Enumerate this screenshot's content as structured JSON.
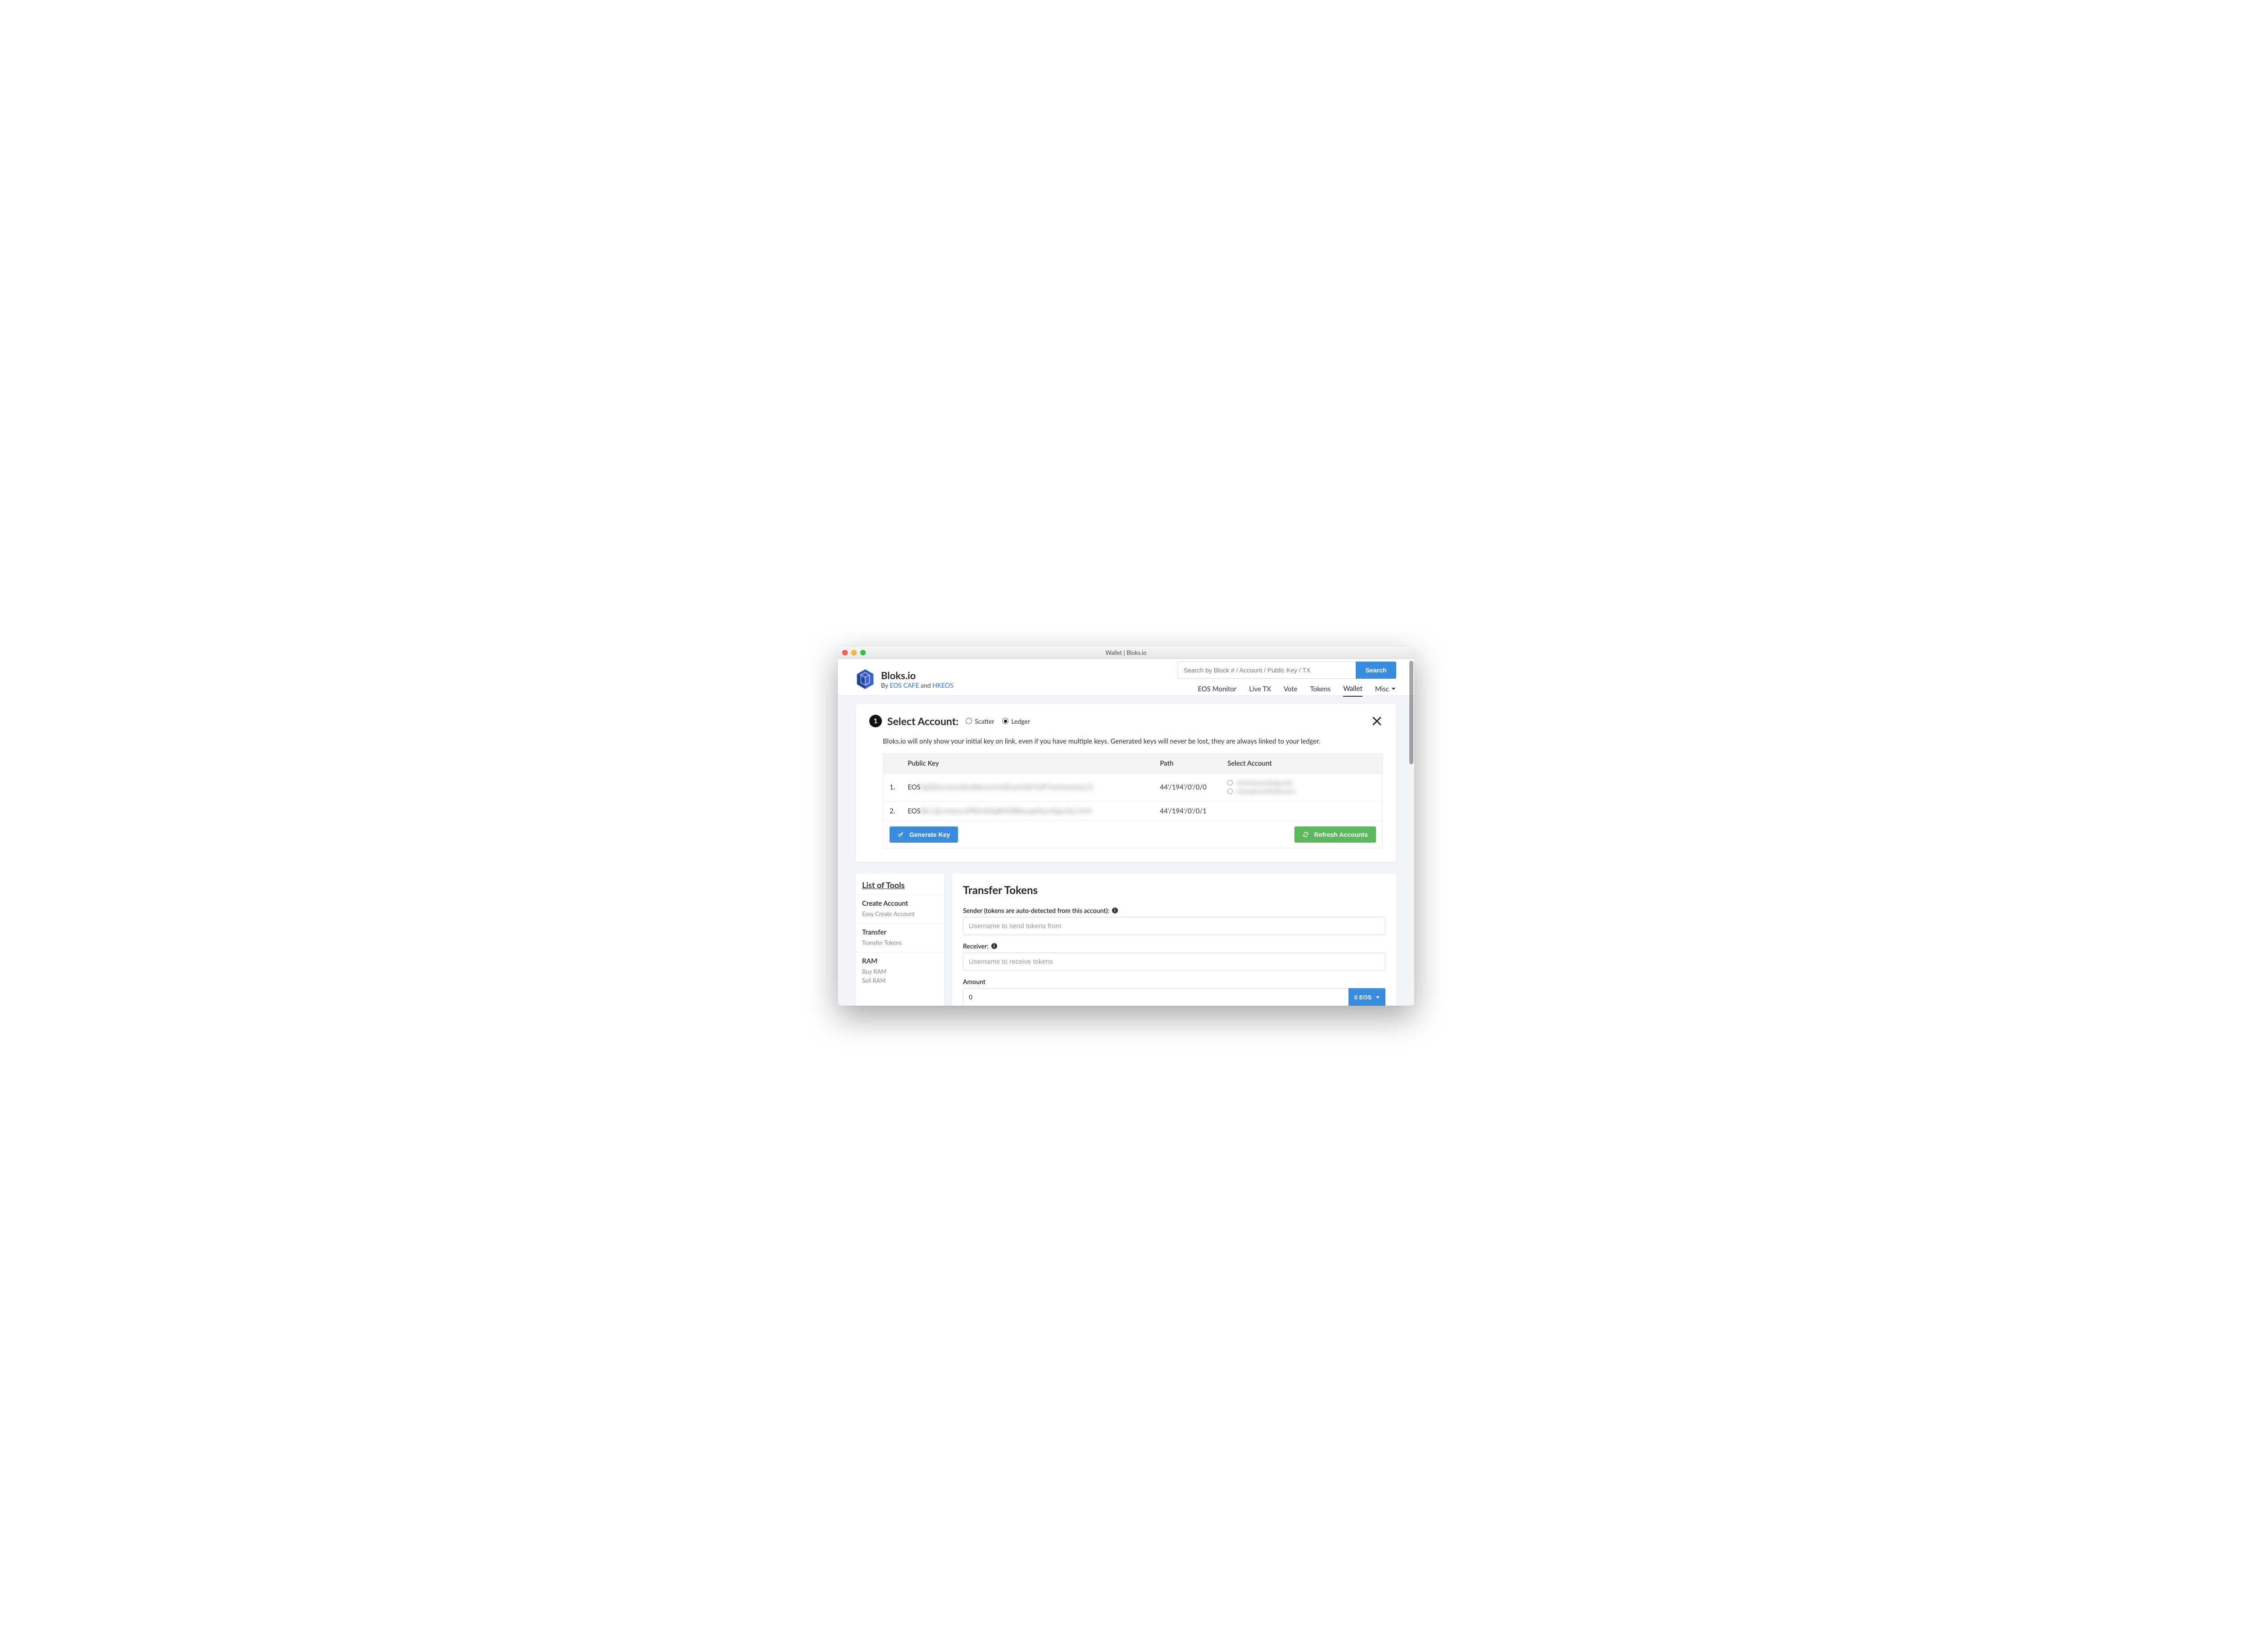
{
  "window": {
    "title": "Wallet | Bloks.io"
  },
  "brand": {
    "name": "Bloks.io",
    "by_prefix": "By ",
    "by_link1": "EOS CAFE",
    "by_mid": " and ",
    "by_link2": "HKEOS"
  },
  "search": {
    "placeholder": "Search by Block # / Account / Public Key / TX",
    "button": "Search"
  },
  "nav": {
    "items": [
      "EOS Monitor",
      "Live TX",
      "Vote",
      "Tokens",
      "Wallet",
      "Misc"
    ],
    "active": "Wallet"
  },
  "select_account": {
    "step": "1",
    "title": "Select Account:",
    "opts": {
      "scatter": "Scatter",
      "ledger": "Ledger"
    },
    "selected": "ledger",
    "info": "Bloks.io will only show your initial key on link, even if you have multiple keys. Generated keys will never be lost, they are always linked to your ledger.",
    "cols": {
      "pk": "Public Key",
      "path": "Path",
      "acct": "Select Account"
    },
    "rows": [
      {
        "idx": "1.",
        "pk_prefix": "EOS",
        "pk_rest": "5gZlDzLmmn2by4bknryCm4EJwmOk7LdFYwnYwwmyL31",
        "path": "44'/194'/0'/0/0",
        "accts": [
          "minirdawoahelga.bm",
          "mlandanawfmikynam"
        ]
      },
      {
        "idx": "2.",
        "pk_prefix": "EOS",
        "pk_rest": "8bc7gLrmyhzunFlRJmkOgROOlBtkyag4faynOgynby1Ym9",
        "path": "44'/194'/0'/0/1",
        "accts": []
      }
    ],
    "generate_btn": "Generate Key",
    "refresh_btn": "Refresh Accounts"
  },
  "tools": {
    "heading": "List of Tools",
    "groups": [
      {
        "title": "Create Account",
        "items": [
          "Easy Create Account"
        ]
      },
      {
        "title": "Transfer",
        "items": [
          "Transfer Tokens"
        ]
      },
      {
        "title": "RAM",
        "items": [
          "Buy RAM",
          "Sell RAM"
        ]
      }
    ]
  },
  "transfer": {
    "title": "Transfer Tokens",
    "sender_label": "Sender (tokens are auto-detected from this account):",
    "sender_placeholder": "Username to send tokens from",
    "receiver_label": "Receiver:",
    "receiver_placeholder": "Username to receive tokens",
    "amount_label": "Amount",
    "amount_value": "0",
    "amount_token": "0 EOS"
  }
}
